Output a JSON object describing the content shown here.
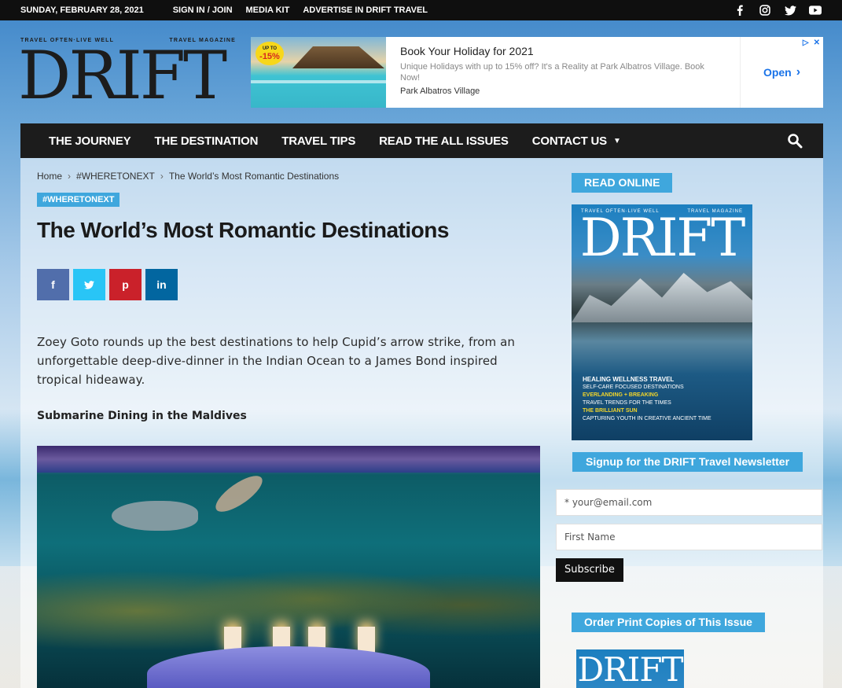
{
  "topbar": {
    "date": "SUNDAY, FEBRUARY 28, 2021",
    "links": [
      "SIGN IN / JOIN",
      "MEDIA KIT",
      "ADVERTISE IN DRIFT TRAVEL"
    ],
    "socials": [
      "facebook-icon",
      "instagram-icon",
      "twitter-icon",
      "youtube-icon"
    ]
  },
  "logo": {
    "tagline_left": "TRAVEL OFTEN·LIVE WELL",
    "tagline_right": "TRAVEL MAGAZINE",
    "wordmark": "DRIFT"
  },
  "ad": {
    "badge_up": "UP TO",
    "badge_pct": "-15%",
    "title": "Book Your Holiday for 2021",
    "description": "Unique Holidays with up to 15% off? It's a Reality at Park Albatros Village. Book Now!",
    "advertiser": "Park Albatros Village",
    "cta": "Open",
    "cta_icon": "chevron-right-icon"
  },
  "nav": {
    "items": [
      "THE JOURNEY",
      "THE DESTINATION",
      "TRAVEL TIPS",
      "READ THE ALL ISSUES",
      "CONTACT US"
    ]
  },
  "breadcrumb": [
    "Home",
    "#WHERETONEXT",
    "The World’s Most Romantic Destinations"
  ],
  "article": {
    "category": "#WHERETONEXT",
    "title": "The World’s Most Romantic Destinations",
    "share": [
      "f",
      "t",
      "p",
      "in"
    ],
    "intro": "Zoey Goto rounds up the best destinations to help Cupid’s arrow strike, from an unforgettable deep-dive-dinner in the Indian Ocean to a James Bond inspired tropical hideaway.",
    "subhead": "Submarine Dining in the Maldives"
  },
  "sidebar": {
    "read_online": "READ ONLINE",
    "magazine": {
      "tagline_left": "TRAVEL OFTEN·LIVE WELL",
      "tagline_right": "TRAVEL MAGAZINE",
      "wordmark": "DRIFT",
      "headline": "HEALING WELLNESS TRAVEL",
      "sub1": "SELF-CARE FOCUSED DESTINATIONS",
      "line2": "EVERLANDING + BREAKING",
      "line2_sub": "TRAVEL TRENDS FOR THE TIMES",
      "line3": "THE BRILLIANT SUN",
      "line3_sub": "CAPTURING YOUTH IN CREATIVE ANCIENT TIME"
    },
    "newsletter_label": "Signup for the DRIFT Travel Newsletter",
    "email_placeholder": "* your@email.com",
    "firstname_placeholder": "First Name",
    "subscribe": "Subscribe",
    "order_label": "Order Print Copies of This Issue",
    "print_wordmark": "DRIFT"
  },
  "colors": {
    "accent": "#3fa7dd",
    "nav_bg": "#1c1c1c",
    "facebook": "#516eab",
    "twitter": "#29c5f6",
    "pinterest": "#ca212a",
    "linkedin": "#0266a0"
  }
}
